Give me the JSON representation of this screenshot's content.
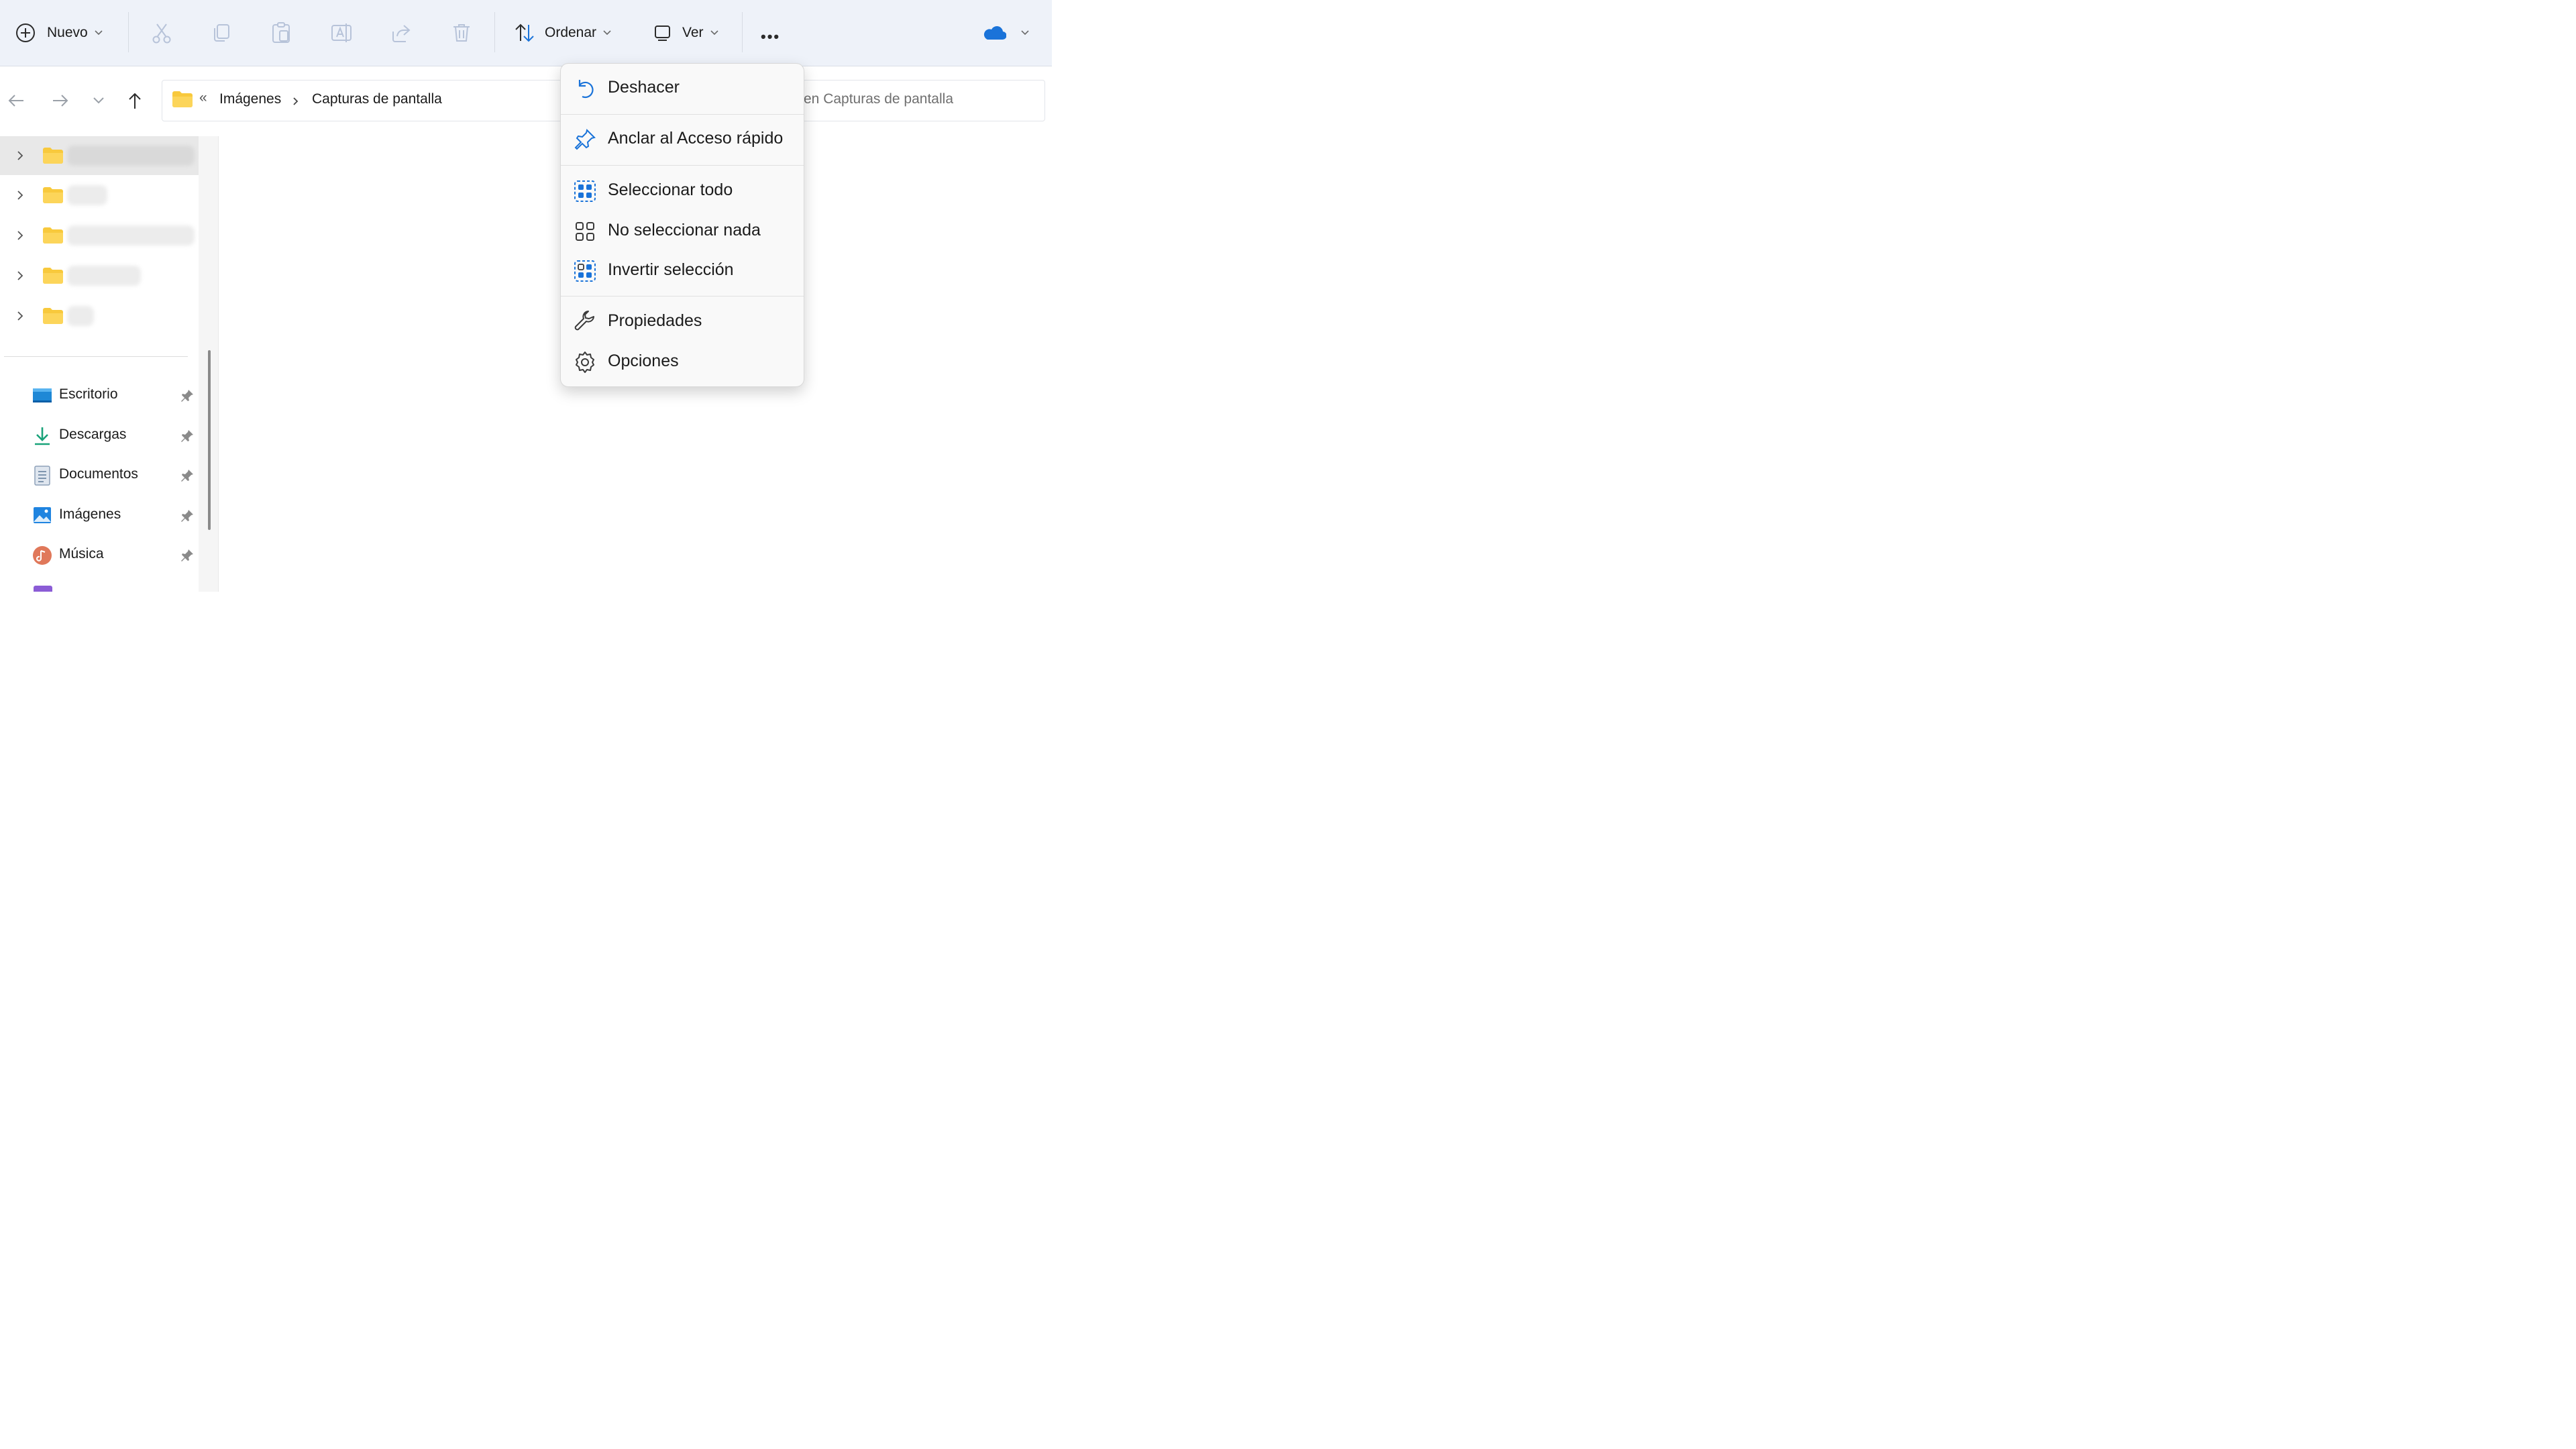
{
  "toolbar": {
    "new_label": "Nuevo",
    "sort_label": "Ordenar",
    "view_label": "Ver",
    "more_label": "•••",
    "icons": [
      "plus-circle-icon",
      "cut-icon",
      "copy-icon",
      "paste-icon",
      "rename-icon",
      "share-icon",
      "delete-icon",
      "sort-icon",
      "view-icon",
      "more-icon",
      "onedrive-icon"
    ],
    "onedrive_color": "#1a73d9"
  },
  "address": {
    "overflow": "«",
    "crumbs": [
      "Imágenes",
      "Capturas de pantalla"
    ],
    "search_placeholder": "en Capturas de pantalla"
  },
  "context_menu": {
    "items": [
      {
        "label": "Deshacer",
        "icon": "undo-icon"
      },
      {
        "label": "Anclar al Acceso rápido",
        "icon": "pin-icon"
      },
      {
        "label": "Seleccionar todo",
        "icon": "select-all-icon"
      },
      {
        "label": "No seleccionar nada",
        "icon": "select-none-icon"
      },
      {
        "label": "Invertir selección",
        "icon": "invert-selection-icon"
      },
      {
        "label": "Propiedades",
        "icon": "wrench-icon"
      },
      {
        "label": "Opciones",
        "icon": "gear-icon"
      }
    ],
    "accent": "#1a73d9"
  },
  "quick_access": {
    "items": [
      {
        "label": "Escritorio",
        "icon": "desktop-icon"
      },
      {
        "label": "Descargas",
        "icon": "download-icon"
      },
      {
        "label": "Documentos",
        "icon": "documents-icon"
      },
      {
        "label": "Imágenes",
        "icon": "pictures-icon"
      },
      {
        "label": "Música",
        "icon": "music-icon"
      }
    ]
  },
  "folder_color": "#f8c93c"
}
